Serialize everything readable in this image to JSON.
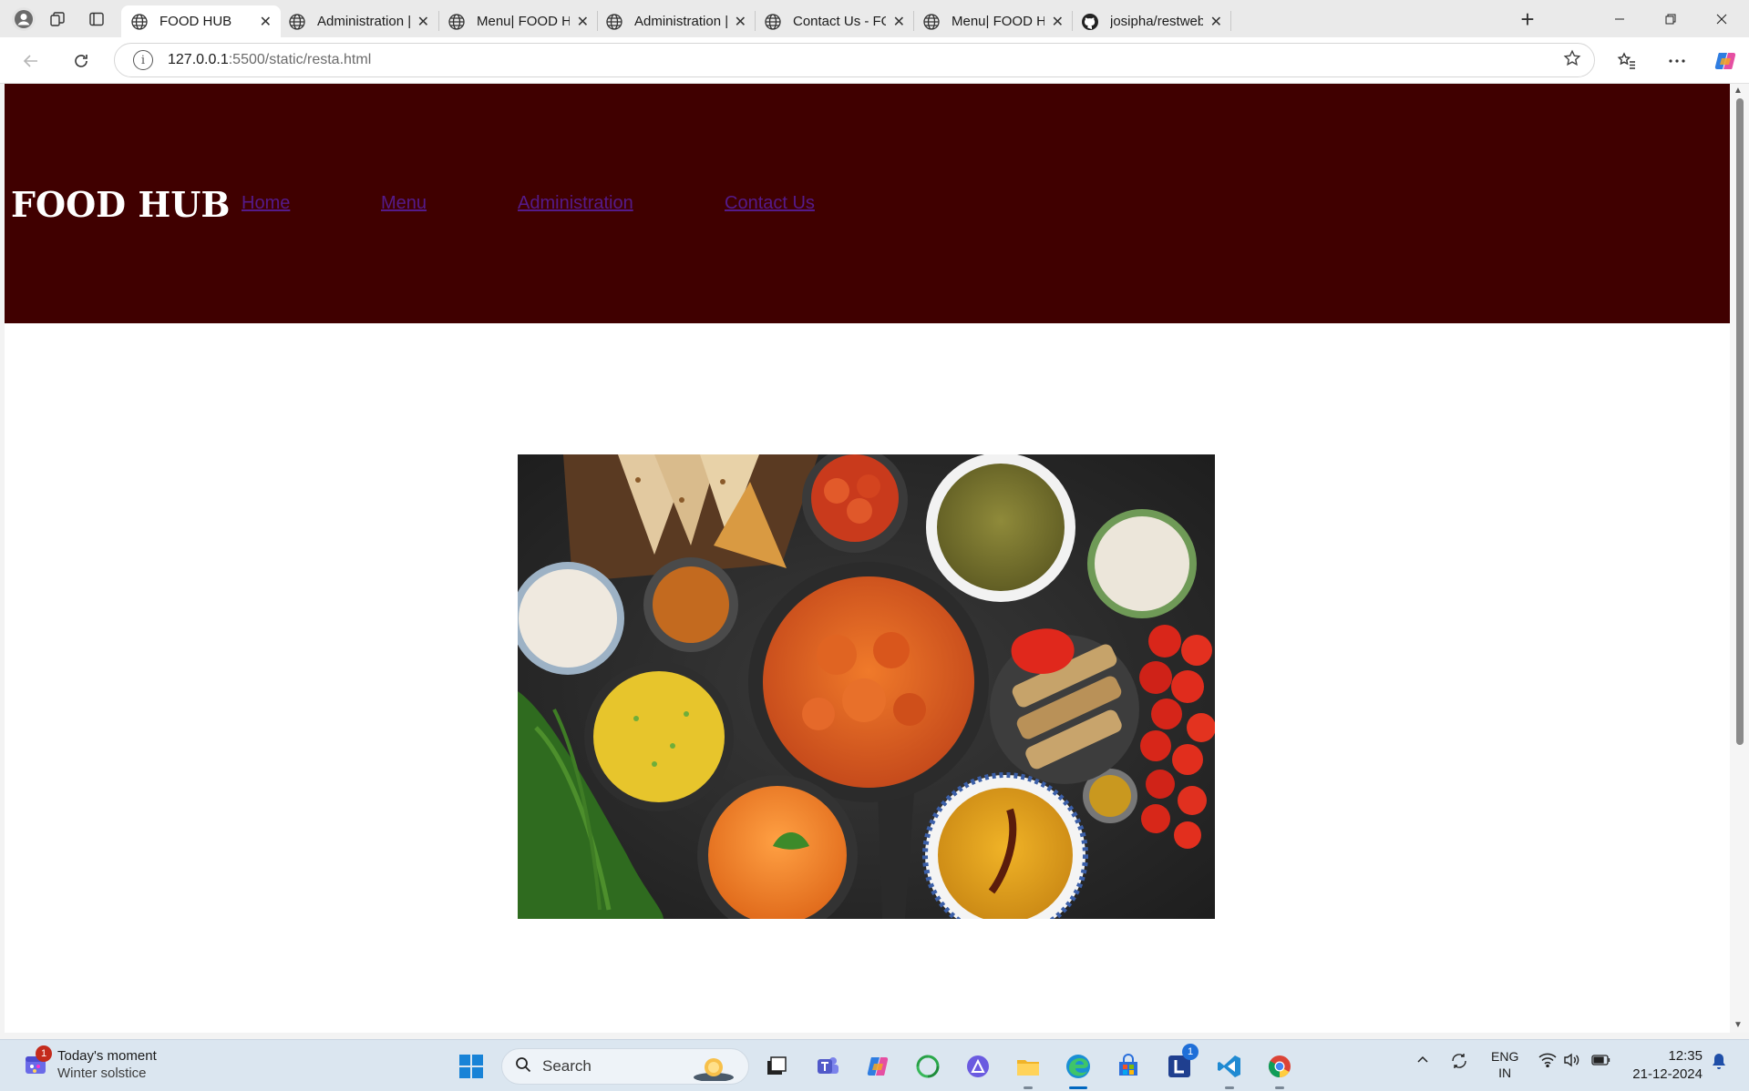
{
  "browser": {
    "tabs": [
      {
        "title": "FOOD HUB",
        "icon": "globe-icon",
        "active": true
      },
      {
        "title": "Administration | FOOD HUB",
        "icon": "globe-icon",
        "active": false
      },
      {
        "title": "Menu| FOOD HUB",
        "icon": "globe-icon",
        "active": false
      },
      {
        "title": "Administration | FOOD HUB",
        "icon": "globe-icon",
        "active": false
      },
      {
        "title": "Contact Us - FOOD HUB",
        "icon": "globe-icon",
        "active": false
      },
      {
        "title": "Menu| FOOD HUB",
        "icon": "globe-icon",
        "active": false
      },
      {
        "title": "josipha/restweb",
        "icon": "github-icon",
        "active": false
      }
    ],
    "address": {
      "host": "127.0.0.1",
      "path": ":5500/static/resta.html"
    }
  },
  "site": {
    "logo": "FOOD HUB",
    "nav": [
      {
        "label": "Home"
      },
      {
        "label": "Menu"
      },
      {
        "label": "Administration"
      },
      {
        "label": "Contact Us"
      }
    ],
    "header_color": "#400000",
    "link_color": "#551a8b"
  },
  "taskbar": {
    "widget": {
      "title": "Today's moment",
      "subtitle": "Winter solstice",
      "badge": "1"
    },
    "search_placeholder": "Search",
    "language": {
      "line1": "ENG",
      "line2": "IN"
    },
    "clock": {
      "time": "12:35",
      "date": "21-12-2024"
    },
    "app_badge": "1"
  }
}
